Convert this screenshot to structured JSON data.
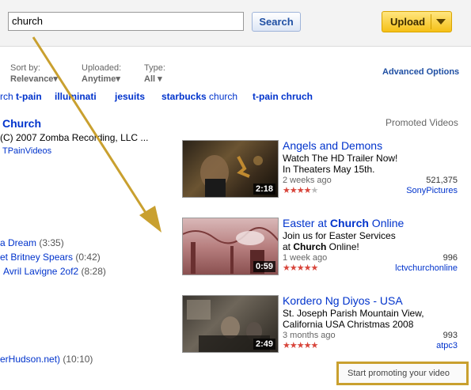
{
  "search": {
    "query": "church",
    "button": "Search"
  },
  "upload": {
    "label": "Upload"
  },
  "filters": {
    "sort": {
      "label": "Sort by:",
      "value": "Relevance▾"
    },
    "uploaded": {
      "label": "Uploaded:",
      "value": "Anytime▾"
    },
    "type": {
      "label": "Type:",
      "value": "All ▾"
    },
    "advanced": "Advanced Options"
  },
  "related": [
    {
      "bold": "t-pain",
      "normal_prefix": "rch "
    },
    {
      "bold": "illuminati"
    },
    {
      "bold": "jesuits"
    },
    {
      "bold": "starbucks",
      "normal": " church"
    },
    {
      "bold": "t-pain chruch"
    }
  ],
  "result": {
    "title": "Church",
    "desc": "(C) 2007 Zomba Recording, LLC ...",
    "user": "TPainVideos"
  },
  "playlist": [
    {
      "title": "a Dream",
      "dur": "(3:35)"
    },
    {
      "title": "et Britney Spears",
      "dur": "(0:42)"
    },
    {
      "title": "Avril Lavigne 2of2",
      "dur": "(8:28)"
    }
  ],
  "last_result": {
    "title": "erHudson.net)",
    "dur": "(10:10)"
  },
  "promoted": {
    "heading": "Promoted Videos",
    "ads": [
      {
        "title": "Angels and Demons",
        "line1": "Watch The HD Trailer Now!",
        "line2": "In Theaters May 15th.",
        "age": "2 weeks ago",
        "views": "521,375",
        "user": "SonyPictures",
        "duration": "2:18",
        "rating": 4
      },
      {
        "title_prefix": "Easter at ",
        "title_bold": "Church",
        "title_suffix": " Online",
        "line1": "Join us for Easter Services",
        "line2_prefix": "at ",
        "line2_bold": "Church",
        "line2_suffix": " Online!",
        "age": "1 week ago",
        "views": "996",
        "user": "lctvchurchonline",
        "duration": "0:59",
        "rating": 5
      },
      {
        "title": "Kordero Ng Diyos - USA",
        "line1": "St. Joseph Parish Mountain View,",
        "line2": "California USA Christmas 2008",
        "age": "3 months ago",
        "views": "993",
        "user": "atpc3",
        "duration": "2:49",
        "rating": 5
      }
    ],
    "promote_link": "Start promoting your video"
  },
  "colors": {
    "accent": "#0033cc",
    "upload": "#f5c017",
    "arrow": "#c9a02f",
    "highlight_box": "#c9a02f"
  }
}
